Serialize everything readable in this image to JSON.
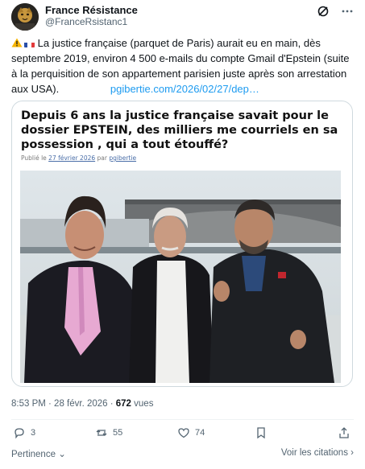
{
  "author": {
    "display_name": "France Résistance",
    "handle": "@FranceRsistanc1"
  },
  "icons": {
    "grok": "slashed-circle-icon",
    "more": "more-icon",
    "reply": "reply-icon",
    "repost": "repost-icon",
    "like": "heart-icon",
    "bookmark": "bookmark-icon",
    "share": "share-icon"
  },
  "post": {
    "text": "La justice française (parquet de Paris) aurait eu en main, dès septembre 2019, environ 4 500 e-mails du compte Gmail d'Epstein (suite à la perquisition de son appartement parisien juste après son arrestation aux USA).",
    "link": "pgibertie.com/2026/02/27/dep…"
  },
  "card": {
    "title": "Depuis 6 ans la justice française savait pour le dossier EPSTEIN, des milliers me courriels en sa possession , qui a tout étouffé?",
    "meta_prefix": "Publié le",
    "meta_date": "27 février 2026",
    "meta_by": "par",
    "meta_author": "pgibertie"
  },
  "meta": {
    "time": "8:53 PM · 28 févr. 2026 · ",
    "views_count": "672",
    "views_label": " vues"
  },
  "actions": {
    "replies": "3",
    "reposts": "55",
    "likes": "74"
  },
  "footer": {
    "relevance": "Pertinence",
    "quotes": "Voir les citations"
  },
  "colors": {
    "link": "#1d9bf0",
    "muted": "#536471",
    "border": "#cfd9de"
  }
}
